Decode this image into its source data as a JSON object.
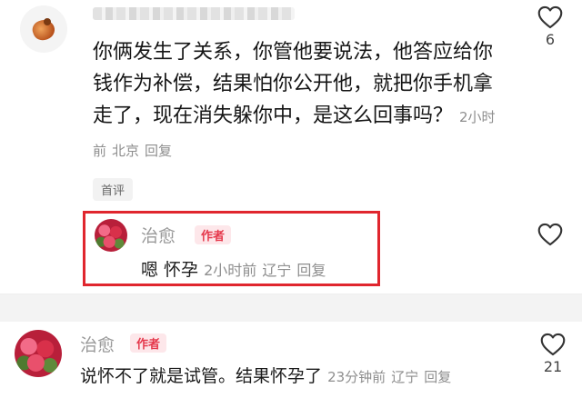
{
  "comment1": {
    "text": "你俩发生了关系，你管他要说法，他答应给你钱作为补偿，结果怕你公开他，就把你手机拿走了，现在消失躲你中，是这么回事吗？",
    "time": "2小时前",
    "location": "北京",
    "reply_label": "回复",
    "badge": "首评",
    "likes": "6"
  },
  "reply1": {
    "username": "治愈",
    "author_badge": "作者",
    "text": "嗯 怀孕",
    "time": "2小时前",
    "location": "辽宁",
    "reply_label": "回复"
  },
  "comment2": {
    "username": "治愈",
    "author_badge": "作者",
    "text": "说怀不了就是试管。结果怀孕了",
    "time": "23分钟前",
    "location": "辽宁",
    "reply_label": "回复",
    "likes": "21"
  },
  "colors": {
    "highlight_box": "#e0262e",
    "author_badge": "#e5394c"
  },
  "icons": [
    "heart-icon"
  ]
}
